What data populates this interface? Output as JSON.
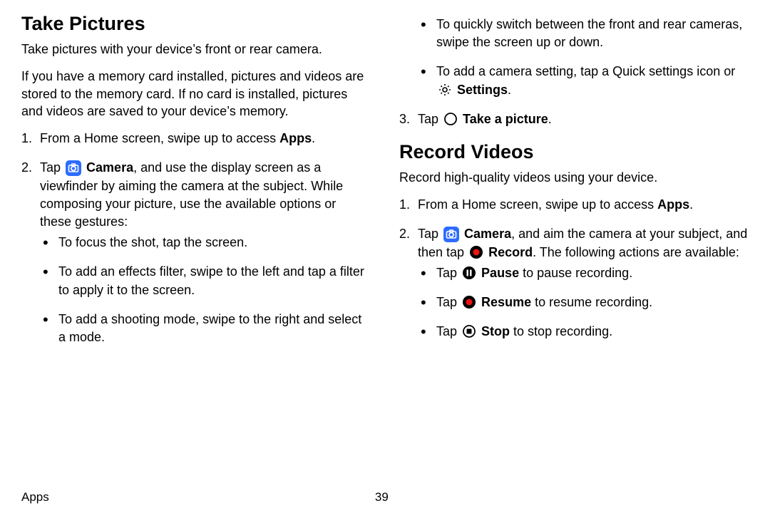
{
  "footer": {
    "section": "Apps",
    "page": "39"
  },
  "left": {
    "h": "Take Pictures",
    "p1": "Take pictures with your device’s front or rear camera.",
    "p2": "If you have a memory card installed, pictures and videos are stored to the memory card. If no card is installed, pictures and videos are saved to your device’s memory.",
    "s1": {
      "num": "1.",
      "a": "From a Home screen, swipe up to access ",
      "b": "Apps",
      "c": "."
    },
    "s2": {
      "num": "2.",
      "a": "Tap ",
      "b": "Camera",
      "c": ", and use the display screen as a viewfinder by aiming the camera at the subject. While composing your picture, use the available options or these gestures:"
    },
    "sub": {
      "a": "To focus the shot, tap the screen.",
      "b": "To add an effects filter, swipe to the left and tap a filter to apply it to the screen.",
      "c": "To add a shooting mode, swipe to the right and select a mode."
    }
  },
  "right": {
    "top": {
      "a": "To quickly switch between the front and rear cameras, swipe the screen up or down.",
      "b1": "To add a camera setting, tap a Quick settings icon or ",
      "b2": "Settings",
      "b3": "."
    },
    "s3": {
      "num": "3.",
      "a": "Tap ",
      "b": "Take a picture",
      "c": "."
    },
    "h": "Record Videos",
    "p": "Record high-quality videos using your device.",
    "s1": {
      "num": "1.",
      "a": "From a Home screen, swipe up to access ",
      "b": "Apps",
      "c": "."
    },
    "s2": {
      "num": "2.",
      "a": "Tap ",
      "b": "Camera",
      "c": ", and aim the camera at your subject, and then tap ",
      "d": "Record",
      "e": ". The following actions are available:"
    },
    "sub": {
      "a1": "Tap ",
      "a2": "Pause",
      "a3": " to pause recording.",
      "b1": "Tap ",
      "b2": "Resume",
      "b3": " to resume recording.",
      "c1": "Tap ",
      "c2": "Stop",
      "c3": " to stop recording."
    }
  }
}
